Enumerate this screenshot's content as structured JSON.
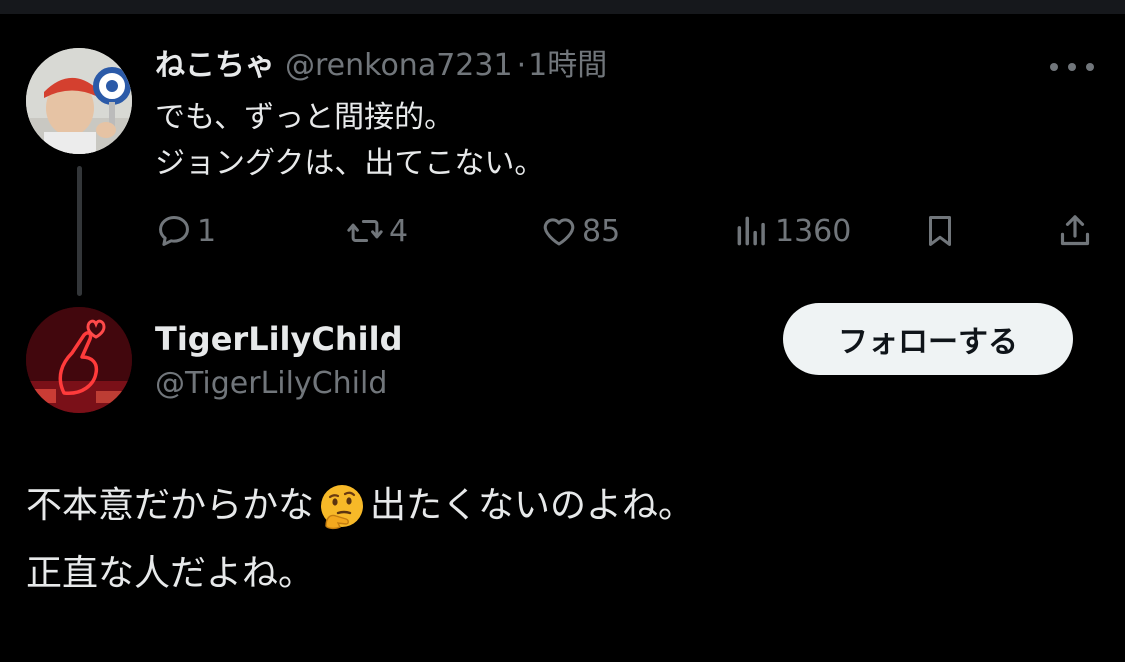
{
  "parent_tweet": {
    "display_name": "ねこちゃ",
    "handle": "@renkona7231",
    "separator": "·",
    "time": "1時間",
    "body_lines": [
      "でも、ずっと間接的。",
      "ジョングクは、出てこない。"
    ],
    "stats": {
      "replies": "1",
      "retweets": "4",
      "likes": "85",
      "views": "1360"
    }
  },
  "main_tweet": {
    "display_name": "TigerLilyChild",
    "handle": "@TigerLilyChild",
    "follow_label": "フォローする",
    "body_line1_before_emoji": "不本意だからかな",
    "emoji": "thinking-face-emoji",
    "body_line1_after_emoji": "出たくないのよね。",
    "body_line2": "正直な人だよね。"
  },
  "colors": {
    "background": "#000000",
    "text": "#e7e9ea",
    "muted": "#71767b",
    "button_bg": "#eff3f4"
  }
}
